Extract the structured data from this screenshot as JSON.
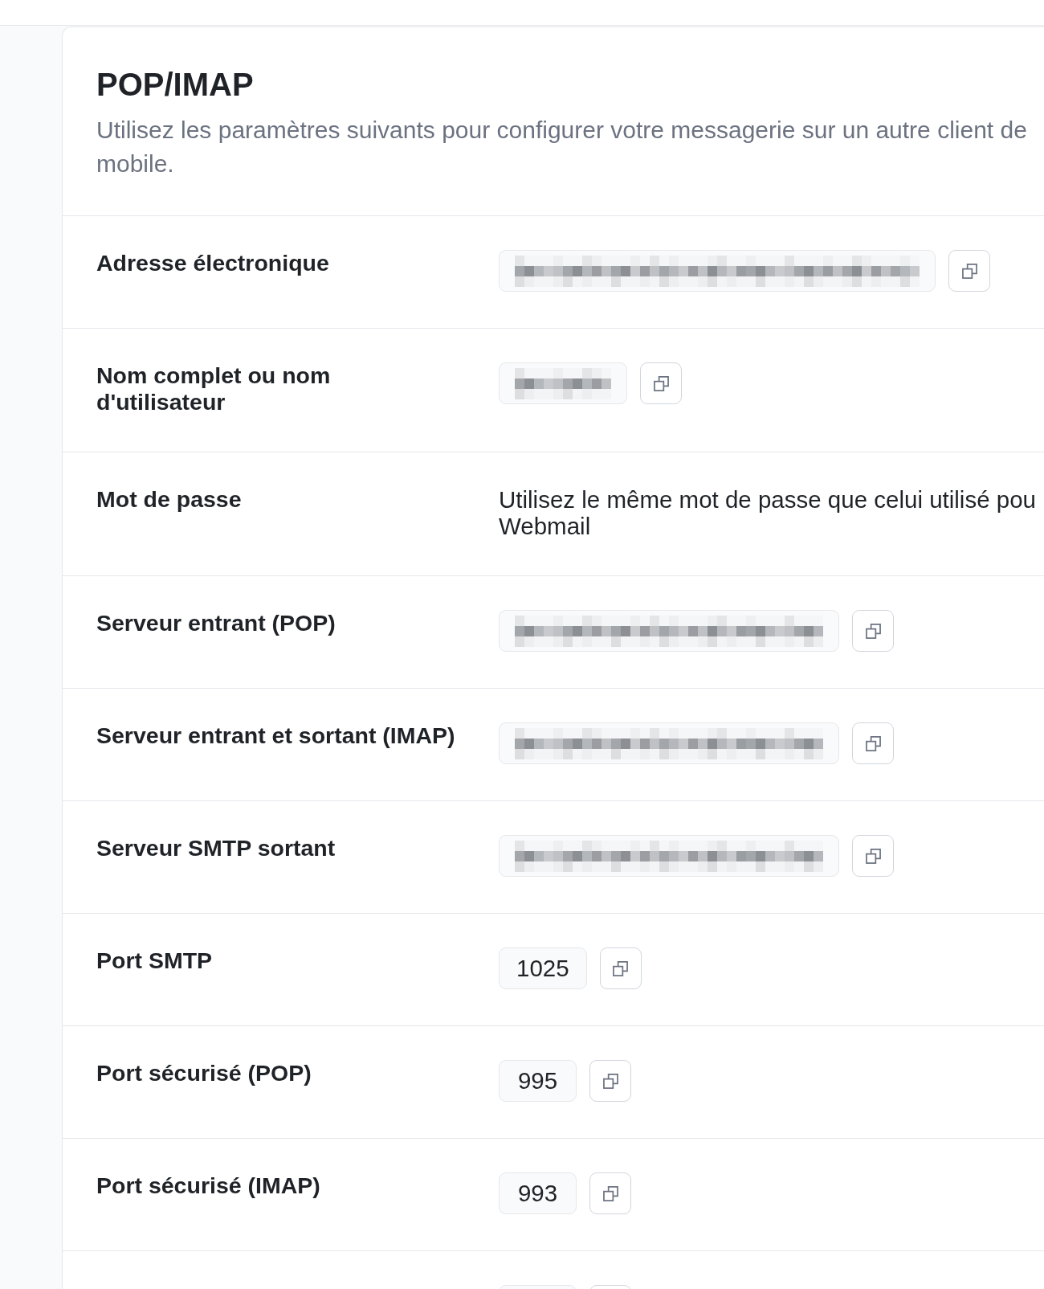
{
  "header": {
    "title": "POP/IMAP",
    "description_lines": [
      "Utilisez les paramètres suivants pour configurer votre messagerie sur un autre client de",
      "mobile."
    ]
  },
  "rows": [
    {
      "label": "Adresse électronique",
      "value": {
        "kind": "redacted"
      },
      "copy_button": true
    },
    {
      "label": "Nom complet ou nom d'utilisateur",
      "value": {
        "kind": "redacted"
      },
      "copy_button": true
    },
    {
      "label": "Mot de passe",
      "value": {
        "kind": "note",
        "lines": [
          "Utilisez le même mot de passe que celui utilisé pou",
          "Webmail"
        ]
      },
      "copy_button": false
    },
    {
      "label": "Serveur entrant (POP)",
      "value": {
        "kind": "redacted"
      },
      "copy_button": true
    },
    {
      "label": "Serveur entrant et sortant (IMAP)",
      "value": {
        "kind": "redacted"
      },
      "copy_button": true
    },
    {
      "label": "Serveur SMTP sortant",
      "value": {
        "kind": "redacted"
      },
      "copy_button": true
    },
    {
      "label": "Port SMTP",
      "value": {
        "kind": "text",
        "text": "1025"
      },
      "copy_button": true
    },
    {
      "label": "Port sécurisé (POP)",
      "value": {
        "kind": "text",
        "text": "995"
      },
      "copy_button": true
    },
    {
      "label": "Port sécurisé (IMAP)",
      "value": {
        "kind": "text",
        "text": "993"
      },
      "copy_button": true
    },
    {
      "value": {
        "kind": "text"
      },
      "copy_button": true
    }
  ]
}
